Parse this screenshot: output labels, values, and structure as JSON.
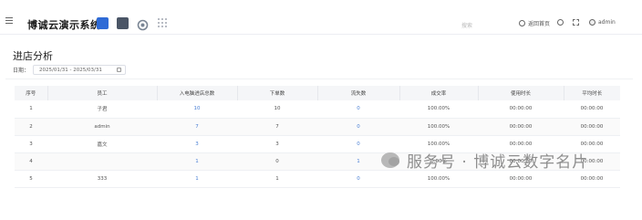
{
  "header": {
    "brand": "博诚云演示系统",
    "search_placeholder": "搜索",
    "right_items": [
      {
        "icon": "home-icon",
        "label": "返回首页"
      },
      {
        "icon": "settings-icon",
        "label": ""
      },
      {
        "icon": "fullscreen-icon",
        "label": ""
      },
      {
        "icon": "avatar-icon",
        "label": "admin"
      }
    ]
  },
  "page": {
    "title": "进店分析",
    "date_label": "日期：",
    "date_range": "2025/01/31 - 2025/03/31"
  },
  "table": {
    "columns": [
      "序号",
      "员工",
      "入电脑进店总数",
      "下单数",
      "流失数",
      "成交率",
      "使用时长",
      "平均时长"
    ],
    "rows": [
      [
        "1",
        "子君",
        "10",
        "10",
        "0",
        "100.00%",
        "00:00:00",
        "00:00:00"
      ],
      [
        "2",
        "admin",
        "7",
        "7",
        "0",
        "100.00%",
        "00:00:00",
        "00:00:00"
      ],
      [
        "3",
        "嘉文",
        "3",
        "3",
        "0",
        "100.00%",
        "00:00:00",
        "00:00:00"
      ],
      [
        "4",
        "",
        "1",
        "0",
        "1",
        "0.00%",
        "00:00:00",
        "00:00:00"
      ],
      [
        "5",
        "333",
        "1",
        "1",
        "0",
        "100.00%",
        "00:00:00",
        "00:00:00"
      ]
    ]
  },
  "watermark": "服务号 · 博诚云数字名片",
  "colors": {
    "link": "#4a7fd4",
    "brand_icon": "#2f6bd6"
  }
}
